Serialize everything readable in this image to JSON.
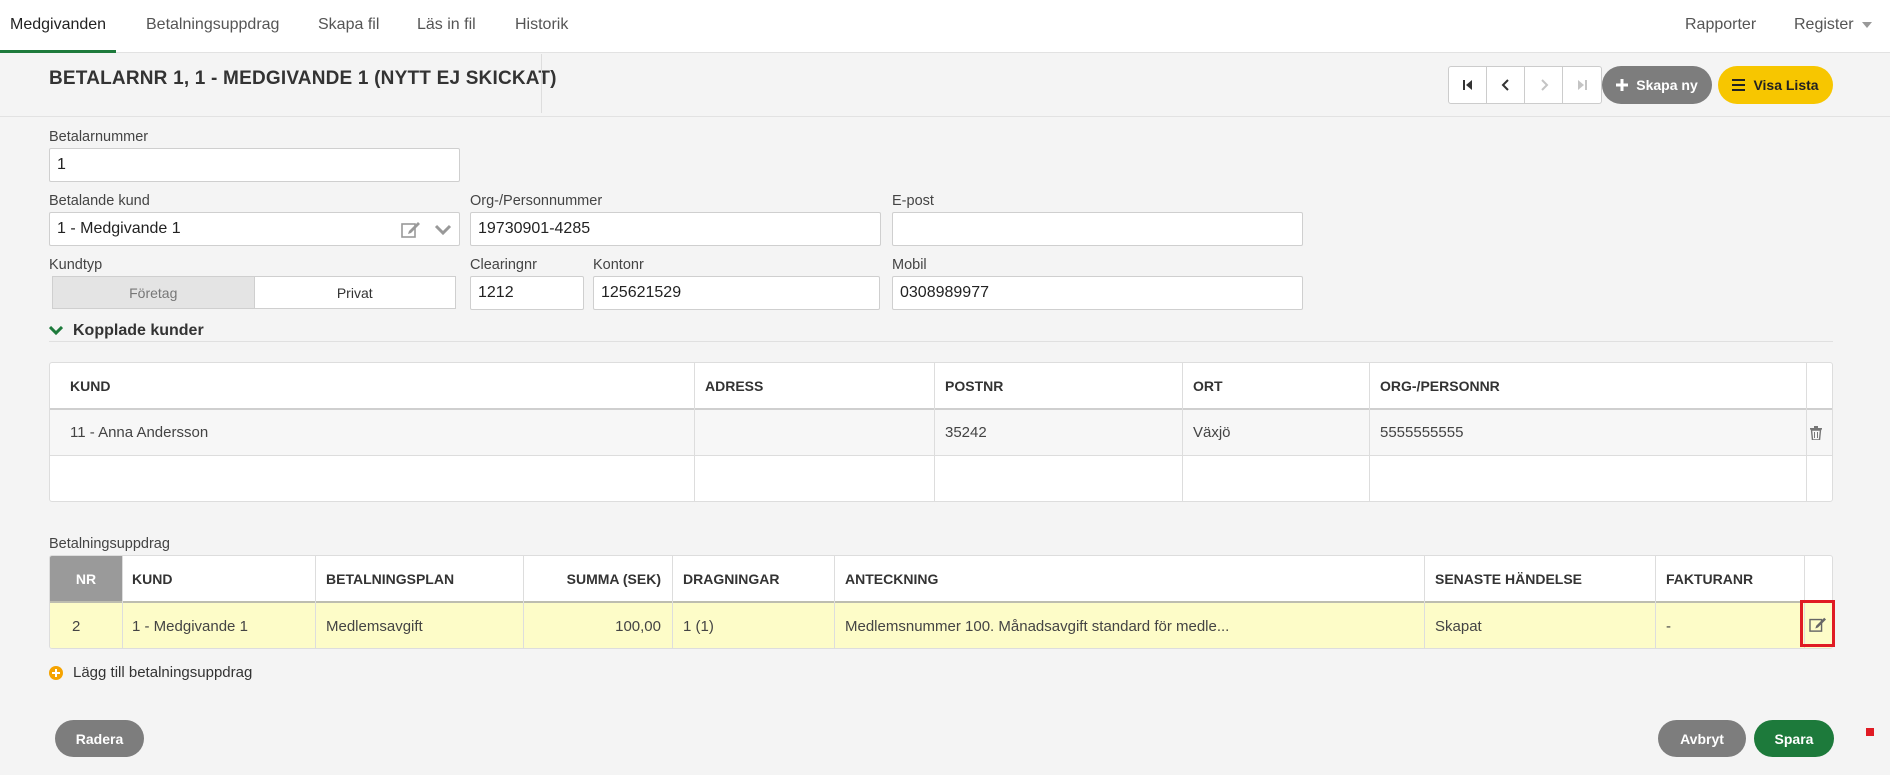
{
  "nav": {
    "tabs": [
      "Medgivanden",
      "Betalningsuppdrag",
      "Skapa fil",
      "Läs in fil",
      "Historik"
    ],
    "right": [
      "Rapporter",
      "Register"
    ]
  },
  "header": {
    "title": "BETALARNR 1, 1 - MEDGIVANDE 1 (NYTT EJ SKICKAT)",
    "create_label": "Skapa ny",
    "list_label": "Visa Lista"
  },
  "form": {
    "betalarnummer_label": "Betalarnummer",
    "betalarnummer_value": "1",
    "betalande_kund_label": "Betalande kund",
    "betalande_kund_value": "1 - Medgivande 1",
    "orgnr_label": "Org-/Personnummer",
    "orgnr_value": "19730901-4285",
    "epost_label": "E-post",
    "epost_value": "",
    "kundtyp_label": "Kundtyp",
    "kundtyp_options": [
      "Företag",
      "Privat"
    ],
    "kundtyp_selected": "Företag",
    "clearing_label": "Clearingnr",
    "clearing_value": "1212",
    "konto_label": "Kontonr",
    "konto_value": "125621529",
    "mobil_label": "Mobil",
    "mobil_value": "0308989977"
  },
  "kopplade": {
    "title": "Kopplade kunder",
    "columns": [
      "KUND",
      "ADRESS",
      "POSTNR",
      "ORT",
      "ORG-/PERSONNR"
    ],
    "rows": [
      [
        "11 - Anna Andersson",
        "",
        "35242",
        "Växjö",
        "5555555555"
      ]
    ]
  },
  "uppdrag": {
    "title": "Betalningsuppdrag",
    "columns": [
      "NR",
      "KUND",
      "BETALNINGSPLAN",
      "SUMMA (SEK)",
      "DRAGNINGAR",
      "ANTECKNING",
      "SENASTE HÄNDELSE",
      "FAKTURANR"
    ],
    "rows": [
      [
        "2",
        "1 - Medgivande 1",
        "Medlemsavgift",
        "100,00",
        "1 (1)",
        "Medlemsnummer 100. Månadsavgift standard för medle...",
        "Skapat",
        "-"
      ]
    ],
    "add_label": "Lägg till betalningsuppdrag"
  },
  "footer": {
    "delete_label": "Radera",
    "cancel_label": "Avbryt",
    "save_label": "Spara"
  },
  "colors": {
    "accent_green": "#1d7a3b",
    "yellow": "#f7c600",
    "highlight_row": "#fdfcc8",
    "marker_red": "#e01b24"
  }
}
